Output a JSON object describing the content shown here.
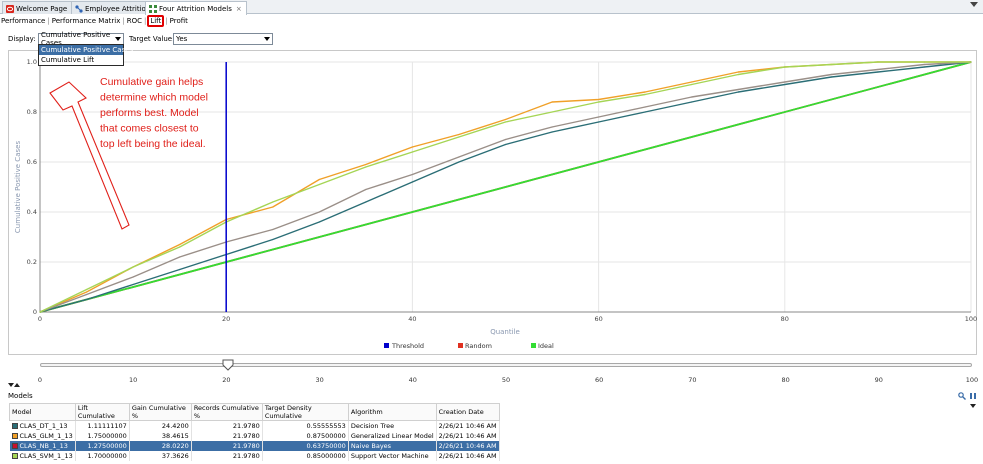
{
  "tabs": [
    {
      "label": "Welcome Page",
      "active": false
    },
    {
      "label": "Employee Attrition",
      "active": false
    },
    {
      "label": "Four Attrition Models",
      "active": true
    }
  ],
  "subtabs": [
    "Performance",
    "Performance Matrix",
    "ROC",
    "Lift",
    "Profit"
  ],
  "toolbar": {
    "display_label": "Display:",
    "display_value": "Cumulative Positive Cases",
    "target_label": "Target Value:",
    "target_value": "Yes"
  },
  "dropdown_options": [
    "Cumulative Positive Cases",
    "Cumulative Lift"
  ],
  "annotation": [
    "Cumulative gain helps",
    "determine which model",
    "performs best.  Model",
    "that comes closest to",
    "top left  being the ideal."
  ],
  "colors": {
    "annotation": "#e0201a",
    "threshold": "#0000cc",
    "random": "#e03020",
    "ideal": "#33dd33",
    "selected_row": "#3c6ea5"
  },
  "chart_data": {
    "type": "line",
    "xlabel": "Quantile",
    "ylabel": "Cumulative Positive Cases",
    "xlim": [
      0,
      100
    ],
    "ylim": [
      0,
      1.0
    ],
    "x_ticks": [
      "0",
      "20",
      "40",
      "60",
      "80",
      "100"
    ],
    "y_ticks": [
      "0",
      "0.2",
      "0.4",
      "0.6",
      "0.8",
      "1.0"
    ],
    "legend": [
      "Threshold",
      "Random",
      "Ideal"
    ],
    "legend_position": "bottom",
    "threshold_x": 20,
    "series": [
      {
        "name": "Random",
        "color": "#e03020",
        "x": [
          0,
          100
        ],
        "y": [
          0,
          1.0
        ]
      },
      {
        "name": "Ideal",
        "color": "#33dd33",
        "x": [
          0,
          100
        ],
        "y": [
          0,
          1.0
        ]
      },
      {
        "name": "CLAS_DT_1_13",
        "color": "#2b6e76",
        "x": [
          0,
          5,
          10,
          15,
          20,
          25,
          30,
          35,
          40,
          45,
          50,
          55,
          60,
          65,
          70,
          75,
          80,
          85,
          90,
          95,
          100
        ],
        "y": [
          0,
          0.05,
          0.11,
          0.17,
          0.23,
          0.29,
          0.36,
          0.44,
          0.52,
          0.6,
          0.67,
          0.72,
          0.76,
          0.8,
          0.84,
          0.88,
          0.91,
          0.94,
          0.96,
          0.98,
          1.0
        ]
      },
      {
        "name": "CLAS_GLM_1_13",
        "color": "#f0a028",
        "x": [
          0,
          5,
          10,
          15,
          20,
          25,
          30,
          35,
          40,
          45,
          50,
          55,
          60,
          65,
          70,
          75,
          80,
          85,
          90,
          95,
          100
        ],
        "y": [
          0,
          0.08,
          0.18,
          0.27,
          0.37,
          0.42,
          0.53,
          0.59,
          0.66,
          0.71,
          0.77,
          0.84,
          0.85,
          0.88,
          0.92,
          0.96,
          0.98,
          0.99,
          1.0,
          1.0,
          1.0
        ]
      },
      {
        "name": "CLAS_NB_1_13",
        "color": "#9a8f88",
        "x": [
          0,
          5,
          10,
          15,
          20,
          25,
          30,
          35,
          40,
          45,
          50,
          55,
          60,
          65,
          70,
          75,
          80,
          85,
          90,
          95,
          100
        ],
        "y": [
          0,
          0.07,
          0.14,
          0.22,
          0.28,
          0.33,
          0.4,
          0.49,
          0.55,
          0.62,
          0.69,
          0.74,
          0.78,
          0.82,
          0.86,
          0.89,
          0.92,
          0.95,
          0.97,
          0.99,
          1.0
        ]
      },
      {
        "name": "CLAS_SVM_1_13",
        "color": "#a5d555",
        "x": [
          0,
          5,
          10,
          15,
          20,
          25,
          30,
          35,
          40,
          45,
          50,
          55,
          60,
          65,
          70,
          75,
          80,
          85,
          90,
          95,
          100
        ],
        "y": [
          0,
          0.09,
          0.18,
          0.26,
          0.36,
          0.44,
          0.51,
          0.58,
          0.64,
          0.7,
          0.76,
          0.8,
          0.84,
          0.87,
          0.91,
          0.95,
          0.98,
          0.99,
          1.0,
          1.0,
          1.0
        ]
      }
    ]
  },
  "slider": {
    "value": 20,
    "ticks": [
      "0",
      "10",
      "20",
      "30",
      "40",
      "50",
      "60",
      "70",
      "80",
      "90",
      "100"
    ]
  },
  "models_panel": {
    "title": "Models",
    "columns": [
      "Model",
      "Lift Cumulative",
      "Gain Cumulative %",
      "Records Cumulative %",
      "Target Density Cumulative",
      "Algorithm",
      "Creation Date"
    ],
    "rows": [
      {
        "swatch": "#2b6e76",
        "model": "CLAS_DT_1_13",
        "lift": "1.11111107",
        "gain": "24.4200",
        "records": "21.9780",
        "density": "0.55555553",
        "algorithm": "Decision Tree",
        "date": "2/26/21 10:46 AM",
        "selected": false
      },
      {
        "swatch": "#f0a028",
        "model": "CLAS_GLM_1_13",
        "lift": "1.75000000",
        "gain": "38.4615",
        "records": "21.9780",
        "density": "0.87500000",
        "algorithm": "Generalized Linear Model",
        "date": "2/26/21 10:46 AM",
        "selected": false
      },
      {
        "swatch": "#c8102e",
        "model": "CLAS_NB_1_13",
        "lift": "1.27500000",
        "gain": "28.0220",
        "records": "21.9780",
        "density": "0.63750000",
        "algorithm": "Naive Bayes",
        "date": "2/26/21 10:46 AM",
        "selected": true
      },
      {
        "swatch": "#a5d555",
        "model": "CLAS_SVM_1_13",
        "lift": "1.70000000",
        "gain": "37.3626",
        "records": "21.9780",
        "density": "0.85000000",
        "algorithm": "Support Vector Machine",
        "date": "2/26/21 10:46 AM",
        "selected": false
      }
    ]
  }
}
